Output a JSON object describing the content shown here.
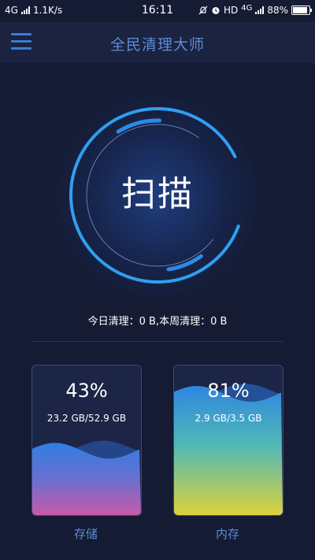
{
  "status_bar": {
    "network": "4G",
    "speed": "1.1K/s",
    "time": "16:11",
    "hd": "HD",
    "network2": "4G",
    "battery": "88%",
    "battery_level": 0.88,
    "icons": [
      "signal-icon",
      "mute-icon",
      "alarm-icon",
      "battery-icon"
    ]
  },
  "app_bar": {
    "title": "全民清理大师",
    "menu_icon": "hamburger-menu-icon"
  },
  "scan": {
    "label": "扫描"
  },
  "stats": {
    "text": "今日清理：0 B,本周清理：0 B"
  },
  "storage": {
    "percent": "43%",
    "percent_value": 0.43,
    "usage": "23.2 GB/52.9 GB",
    "label": "存储"
  },
  "memory": {
    "percent": "81%",
    "percent_value": 0.81,
    "usage": "2.9 GB/3.5 GB",
    "label": "内存"
  },
  "colors": {
    "background": "#141b33",
    "accent_blue": "#2e9af0",
    "title_blue": "#5d8bd4"
  }
}
